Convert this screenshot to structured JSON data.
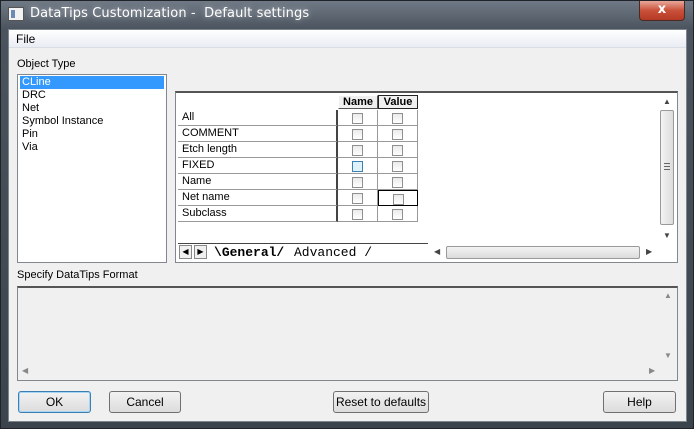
{
  "window": {
    "title": "DataTips Customization -  Default settings",
    "close_label": "x"
  },
  "menu": {
    "file": "File"
  },
  "object_type": {
    "label": "Object Type",
    "items": [
      "CLine",
      "DRC",
      "Net",
      "Symbol Instance",
      "Pin",
      "Via"
    ],
    "selected": "CLine"
  },
  "grid": {
    "headers": {
      "name": "Name",
      "value": "Value"
    },
    "rows": [
      {
        "label": "All",
        "name_checked": false,
        "value_checked": false
      },
      {
        "label": "COMMENT",
        "name_checked": false,
        "value_checked": false
      },
      {
        "label": "Etch length",
        "name_checked": false,
        "value_checked": false
      },
      {
        "label": "FIXED",
        "name_checked": false,
        "value_checked": false
      },
      {
        "label": "Name",
        "name_checked": false,
        "value_checked": false
      },
      {
        "label": "Net name",
        "name_checked": false,
        "value_checked": false
      },
      {
        "label": "Subclass",
        "name_checked": false,
        "value_checked": false
      }
    ],
    "tabs": [
      "General",
      "Advanced"
    ],
    "active_tab": "General"
  },
  "format": {
    "label": "Specify DataTips Format",
    "value": ""
  },
  "buttons": {
    "ok": "OK",
    "cancel": "Cancel",
    "reset": "Reset to defaults",
    "help": "Help"
  },
  "icons": {
    "app": "app-window-icon",
    "close": "close-icon",
    "scroll_up": "scroll-up-arrow-icon",
    "scroll_down": "scroll-down-arrow-icon",
    "scroll_left": "scroll-left-arrow-icon",
    "scroll_right": "scroll-right-arrow-icon"
  }
}
